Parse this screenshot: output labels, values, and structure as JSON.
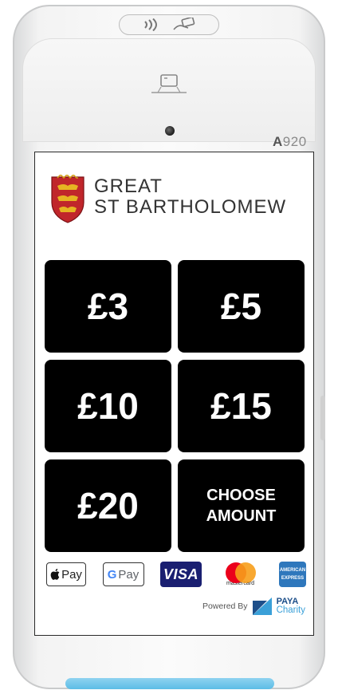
{
  "device": {
    "model_prefix": "A",
    "model_number": "920",
    "accent_color": "#5cbde6"
  },
  "brand": {
    "line1": "GREAT",
    "line2": "ST BARTHOLOMEW",
    "crest_icon": "shield-crest-icon",
    "crest_color": "#c0262b"
  },
  "amounts": {
    "a3": "£3",
    "a5": "£5",
    "a10": "£10",
    "a15": "£15",
    "a20": "£20",
    "choose_line1": "CHOOSE",
    "choose_line2": "AMOUNT"
  },
  "payments": {
    "apple_pay": "Pay",
    "google_pay_g": "G",
    "google_pay": "Pay",
    "visa": "VISA",
    "mastercard": "mastercard",
    "amex_line1": "AMERICAN",
    "amex_line2": "EXPRESS"
  },
  "footer": {
    "powered_by": "Powered By",
    "provider_line1": "PAYA",
    "provider_line2": "Charity"
  }
}
